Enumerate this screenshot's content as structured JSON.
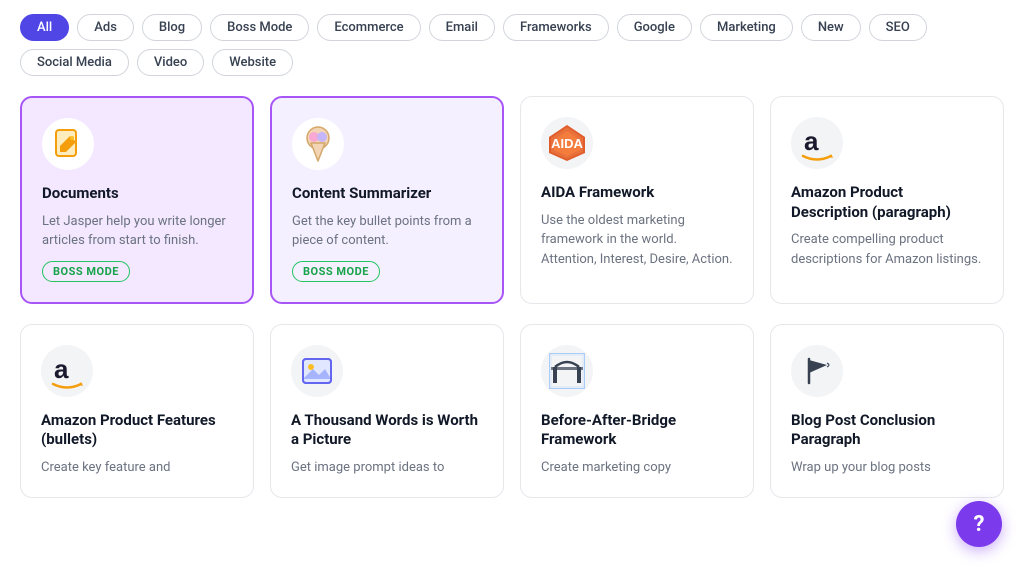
{
  "filters": [
    {
      "label": "All",
      "active": true
    },
    {
      "label": "Ads",
      "active": false
    },
    {
      "label": "Blog",
      "active": false
    },
    {
      "label": "Boss Mode",
      "active": false
    },
    {
      "label": "Ecommerce",
      "active": false
    },
    {
      "label": "Email",
      "active": false
    },
    {
      "label": "Frameworks",
      "active": false
    },
    {
      "label": "Google",
      "active": false
    },
    {
      "label": "Marketing",
      "active": false
    },
    {
      "label": "New",
      "active": false
    },
    {
      "label": "SEO",
      "active": false
    },
    {
      "label": "Social Media",
      "active": false
    },
    {
      "label": "Video",
      "active": false
    },
    {
      "label": "Website",
      "active": false
    }
  ],
  "cards_row1": [
    {
      "id": "documents",
      "title": "Documents",
      "desc": "Let Jasper help you write longer articles from start to finish.",
      "boss_mode": true,
      "style": "purple-light",
      "icon": "📝"
    },
    {
      "id": "content-summarizer",
      "title": "Content Summarizer",
      "desc": "Get the key bullet points from a piece of content.",
      "boss_mode": true,
      "style": "purple-lighter",
      "icon": "🍦"
    },
    {
      "id": "aida-framework",
      "title": "AIDA Framework",
      "desc": "Use the oldest marketing framework in the world. Attention, Interest, Desire, Action.",
      "boss_mode": false,
      "style": "normal",
      "icon": "aida"
    },
    {
      "id": "amazon-product-desc",
      "title": "Amazon Product Description (paragraph)",
      "desc": "Create compelling product descriptions for Amazon listings.",
      "boss_mode": false,
      "style": "normal",
      "icon": "amazon"
    }
  ],
  "cards_row2": [
    {
      "id": "amazon-product-features",
      "title": "Amazon Product Features (bullets)",
      "desc": "Create key feature and",
      "boss_mode": false,
      "style": "normal",
      "icon": "amazon"
    },
    {
      "id": "thousand-words",
      "title": "A Thousand Words is Worth a Picture",
      "desc": "Get image prompt ideas to",
      "boss_mode": false,
      "style": "normal",
      "icon": "🖼️"
    },
    {
      "id": "before-after-bridge",
      "title": "Before-After-Bridge Framework",
      "desc": "Create marketing copy",
      "boss_mode": false,
      "style": "normal",
      "icon": "🌉"
    },
    {
      "id": "blog-post-conclusion",
      "title": "Blog Post Conclusion Paragraph",
      "desc": "Wrap up your blog posts",
      "boss_mode": false,
      "style": "normal",
      "icon": "🏁"
    }
  ],
  "boss_mode_label": "BOSS MODE",
  "help_label": "?"
}
